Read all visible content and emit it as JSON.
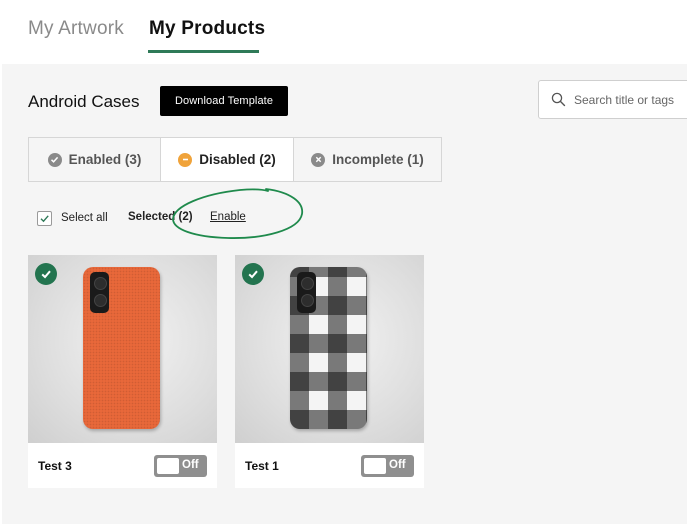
{
  "top_tabs": {
    "artwork": "My Artwork",
    "products": "My Products"
  },
  "section": {
    "title": "Android Cases",
    "download_label": "Download Template"
  },
  "search": {
    "placeholder": "Search title or tags"
  },
  "filter_tabs": [
    {
      "label": "Enabled (3)",
      "icon": "check-circle-icon"
    },
    {
      "label": "Disabled (2)",
      "icon": "minus-circle-icon",
      "active": true
    },
    {
      "label": "Incomplete (1)",
      "icon": "x-circle-icon"
    }
  ],
  "selection": {
    "select_all_label": "Select all",
    "select_all_checked": true,
    "selected_label": "Selected (2)",
    "enable_link": "Enable"
  },
  "products": [
    {
      "name": "Test 3",
      "toggle_label": "Off",
      "selected": true,
      "design": "orange"
    },
    {
      "name": "Test 1",
      "toggle_label": "Off",
      "selected": true,
      "design": "black-white-plaid"
    }
  ],
  "colors": {
    "accent_green": "#2f7a58",
    "badge_green": "#23744f",
    "disabled_orange": "#f0a33a",
    "muted_gray": "#8f8f8f",
    "annotation_green": "#1f8a4c"
  }
}
